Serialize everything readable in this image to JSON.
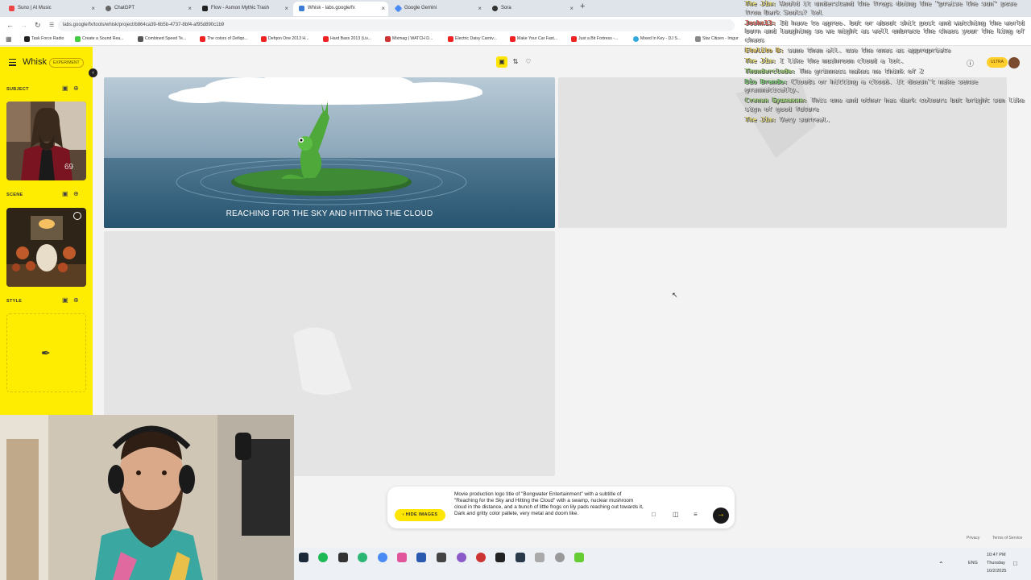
{
  "browser": {
    "tabs": [
      {
        "label": "Suno | AI Music",
        "color": "#e44"
      },
      {
        "label": "ChatGPT",
        "color": "#666"
      },
      {
        "label": "Flow - Asmon Mythic Trash",
        "color": "#222"
      },
      {
        "label": "Whisk - labs.google/fx",
        "color": "#3a7bd5"
      },
      {
        "label": "Google Gemini",
        "color": "#4a8af4"
      },
      {
        "label": "Sora",
        "color": "#333"
      }
    ],
    "close_glyph": "×",
    "newtab_glyph": "+",
    "url": "labs.google/fx/tools/whisk/project/b864ca39-6b5b-4737-8bf4-af95d890c1b9",
    "bookmarks": [
      {
        "label": "Task Force Radio",
        "color": "#222"
      },
      {
        "label": "Create a Sound Rea...",
        "color": "#4c4"
      },
      {
        "label": "Combined Speed Te...",
        "color": "#555"
      },
      {
        "label": "The colors of Defiqo...",
        "color": "#e22"
      },
      {
        "label": "Defqon One 2013 H...",
        "color": "#e22"
      },
      {
        "label": "Hard Bass 2013 (Liv...",
        "color": "#e22"
      },
      {
        "label": "Mixmag | WATCH D...",
        "color": "#c33"
      },
      {
        "label": "Electric Daisy Carniv...",
        "color": "#e22"
      },
      {
        "label": "Make Your Car Fast...",
        "color": "#e22"
      },
      {
        "label": "Just a Bit Fortress -...",
        "color": "#e22"
      },
      {
        "label": "Mixed In Key - DJ S...",
        "color": "#3ad"
      },
      {
        "label": "Star Citizen - Imgur",
        "color": "#888"
      }
    ]
  },
  "app": {
    "brand": "Whisk",
    "badge": "EXPERIMENT",
    "accent": "#ffed00",
    "sections": [
      {
        "label": "SUBJECT"
      },
      {
        "label": "SCENE"
      },
      {
        "label": "STYLE"
      }
    ],
    "user_badge": "ULTRA"
  },
  "images": [
    {
      "caption": "REACHING FOR THE SKY AND HITTING THE CLOUD"
    }
  ],
  "prompt": {
    "hide_images_label": "HIDE IMAGES",
    "text": "Movie production logo title of \"Bongwater Entertainment\" with a subtitle of \"Reaching for the Sky and Hitting the Cloud\" with a swamp, nuclear mushroom cloud in the distance, and a bunch of little frogs on lily pads reaching out towards it, Dark and gritty color pallete, very metal and doom like."
  },
  "footer": {
    "privacy": "Privacy",
    "terms": "Terms of Service"
  },
  "chat": [
    {
      "name": "The Jim:",
      "text": " Would it understand the frogs doing the \"praise the sun\" pose from Dark Souls? lol",
      "color": "#e8e07a"
    },
    {
      "name": "Joshx13:",
      "text": " Id have to agree. but or about shit post and watching the world burn and laughing so we might as well embrace the chaos your the king of chaos",
      "color": "#e36a5c"
    },
    {
      "name": "Etalito B:",
      "text": " same them all. use the ones as appropriate",
      "color": "#e8c85a"
    },
    {
      "name": "The Jim:",
      "text": " I like the mushroom cloud a lot.",
      "color": "#e8e07a"
    },
    {
      "name": "Thunderclede:",
      "text": " The grimness makes me think of 2",
      "color": "#9fd37a"
    },
    {
      "name": "Dio Brando:",
      "text": " Clouds or hitting a cloud. it doesn't make sense grammatically.",
      "color": "#7fd37a"
    },
    {
      "name": "Степан Бушмакин:",
      "text": " This one and other has dark colours but bright sun like sign of good future",
      "color": "#9fd37a"
    },
    {
      "name": "The Jim:",
      "text": " Very surreal.",
      "color": "#e8e07a"
    }
  ],
  "taskbar": {
    "lang": "ENG",
    "time": "10:47 PM",
    "day": "Thursday",
    "date": "10/2/2025"
  }
}
